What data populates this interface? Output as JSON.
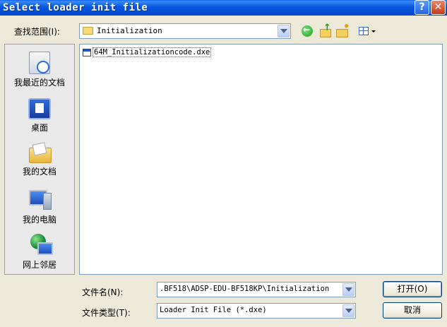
{
  "window": {
    "title": "Select loader init file",
    "help_label": "?",
    "close_label": "✕"
  },
  "lookin": {
    "label": "查找范围(I):",
    "value": "Initialization"
  },
  "toolbar": {
    "icons": [
      "back-icon",
      "up-folder-icon",
      "new-folder-icon",
      "views-menu-icon"
    ]
  },
  "places": [
    {
      "label": "我最近的文档",
      "icon": "recent-documents-icon"
    },
    {
      "label": "桌面",
      "icon": "desktop-icon"
    },
    {
      "label": "我的文档",
      "icon": "my-documents-icon"
    },
    {
      "label": "我的电脑",
      "icon": "my-computer-icon"
    },
    {
      "label": "网上邻居",
      "icon": "network-places-icon"
    }
  ],
  "files": [
    {
      "name": "64M_Initializationcode.dxe",
      "icon": "dxe-file-icon"
    }
  ],
  "filename": {
    "label": "文件名(N):",
    "value": ".BF518\\ADSP-EDU-BF518KP\\Initialization"
  },
  "filetype": {
    "label": "文件类型(T):",
    "value": "Loader Init File (*.dxe)"
  },
  "buttons": {
    "open": "打开(O)",
    "cancel": "取消"
  },
  "colors": {
    "titlebar": "#0856df",
    "dialog_bg": "#ece9d8"
  }
}
